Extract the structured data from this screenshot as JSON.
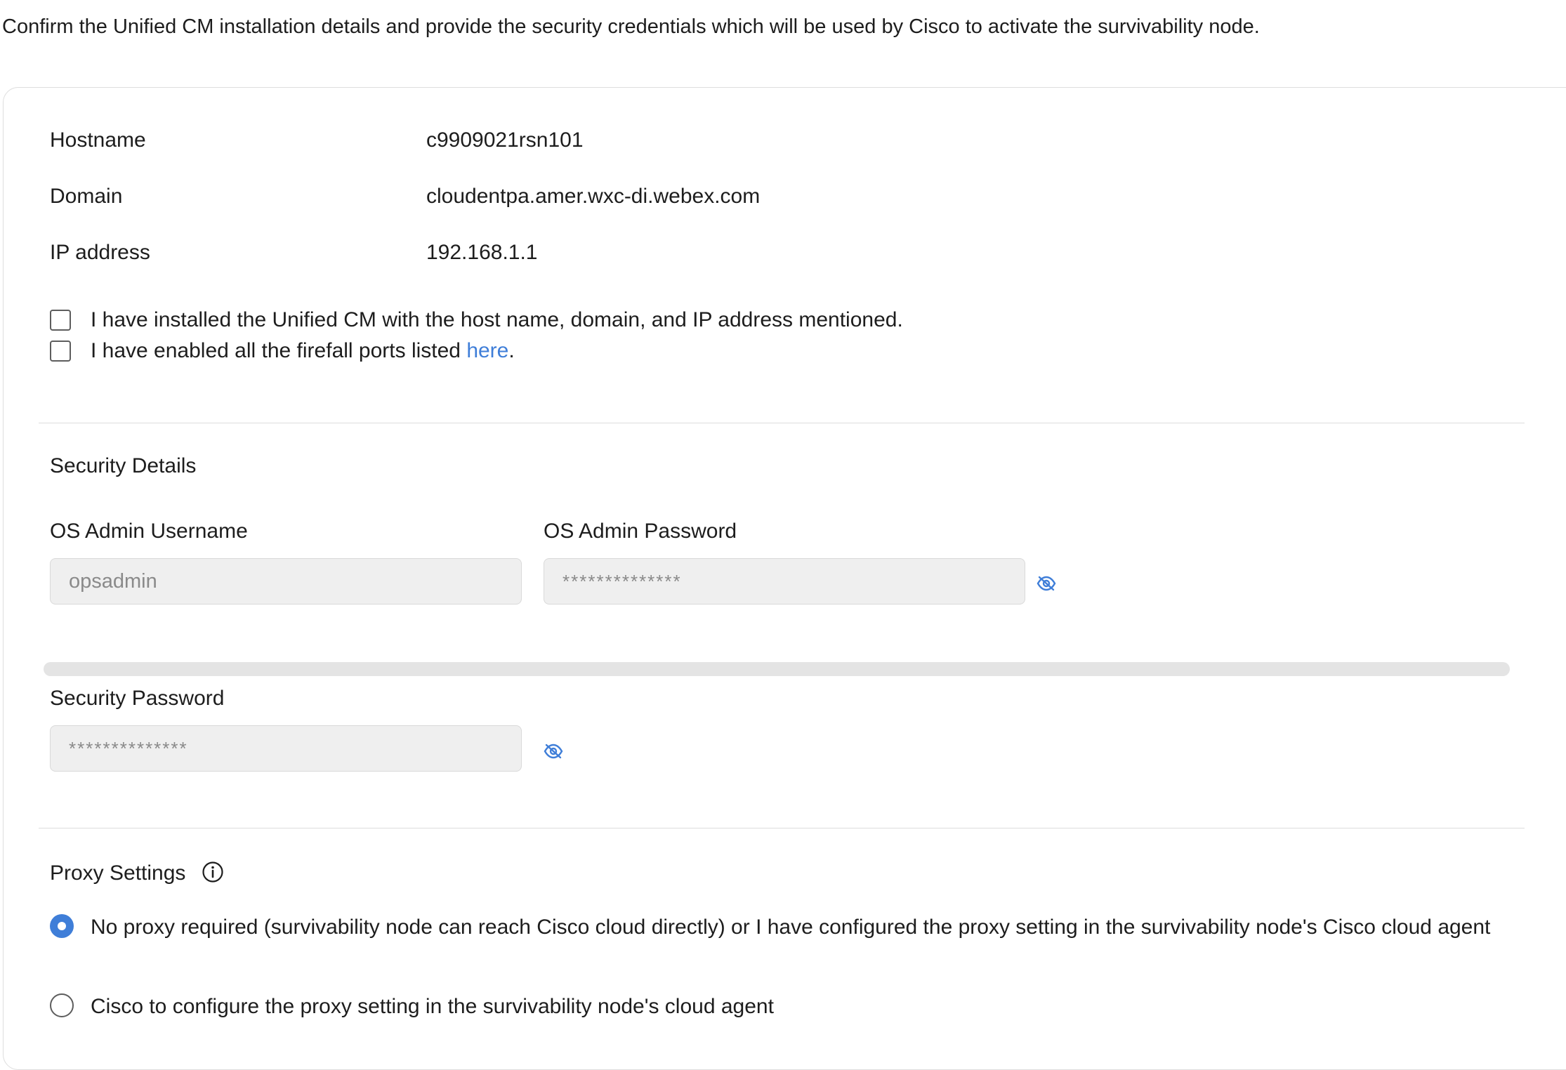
{
  "intro_text": "Confirm the Unified CM installation details and provide the security credentials which will be used by Cisco to activate the survivability node.",
  "node_info": {
    "hostname_label": "Hostname",
    "hostname_value": "c9909021rsn101",
    "domain_label": "Domain",
    "domain_value": "cloudentpa.amer.wxc-di.webex.com",
    "ip_label": "IP address",
    "ip_value": "192.168.1.1"
  },
  "confirmations": {
    "installed_text": "I have installed the Unified CM with the host name, domain, and IP address mentioned.",
    "installed_checked": false,
    "ports_text_before": "I have enabled all the firefall ports listed ",
    "ports_link": "here",
    "ports_text_after": ".",
    "ports_checked": false
  },
  "security": {
    "title": "Security Details",
    "username_label": "OS Admin Username",
    "username_value": "opsadmin",
    "admin_password_label": "OS Admin Password",
    "admin_password_value": "**************",
    "security_password_label": "Security Password",
    "security_password_value": "**************",
    "password_strength": 0
  },
  "proxy": {
    "title": "Proxy Settings",
    "options": [
      {
        "label": "No proxy required (survivability node can reach Cisco cloud directly) or I have configured the proxy setting in the survivability node's Cisco cloud agent",
        "selected": true
      },
      {
        "label": "Cisco to configure the proxy setting in the survivability node's cloud agent",
        "selected": false
      }
    ]
  },
  "colors": {
    "accent": "#3f7ed8",
    "text": "#1d1d1d",
    "field_bg": "#efefef",
    "divider": "#dcdcdc"
  },
  "icons": {
    "password_toggle": "eye-slash-icon",
    "proxy_info": "info-circle-icon"
  }
}
